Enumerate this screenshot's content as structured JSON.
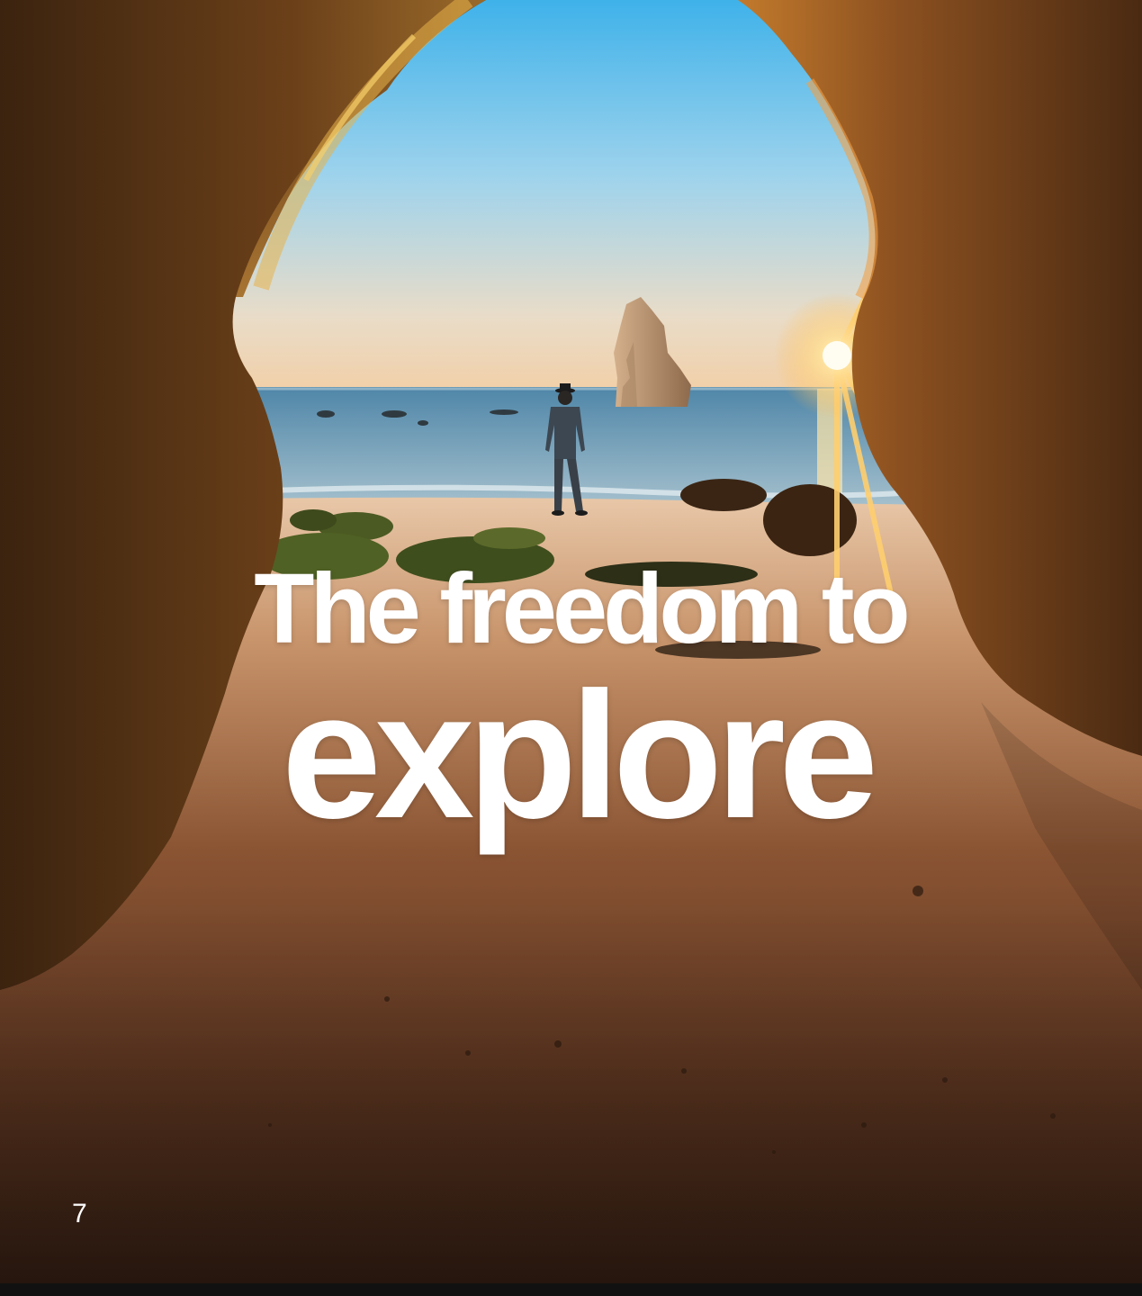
{
  "title": {
    "line1": "The freedom to",
    "line2": "explore"
  },
  "page_number": "7",
  "colors": {
    "title_text": "#ffffff",
    "sky_top": "#5ab8e8",
    "sea": "#6f9ab6",
    "sand": "#7a4a2c",
    "rock": "#6b3f1c",
    "sun": "#ffd27a"
  }
}
